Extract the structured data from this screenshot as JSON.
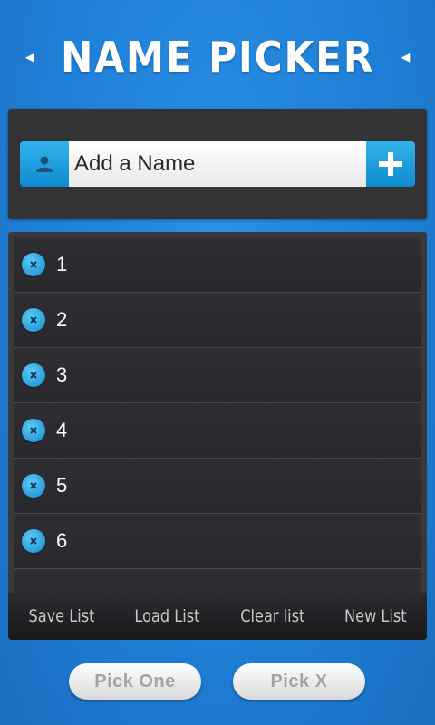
{
  "header": {
    "title": "NAME PICKER"
  },
  "input": {
    "placeholder": "Add a Name"
  },
  "list": {
    "items": [
      "1",
      "2",
      "3",
      "4",
      "5",
      "6"
    ]
  },
  "toolbar": {
    "save": "Save List",
    "load": "Load List",
    "clear": "Clear list",
    "new": "New List"
  },
  "actions": {
    "pick_one": "Pick One",
    "pick_x": "Pick X"
  },
  "colors": {
    "accent": "#1a8fd8",
    "background": "#1e7fd6",
    "panel": "#333336"
  }
}
